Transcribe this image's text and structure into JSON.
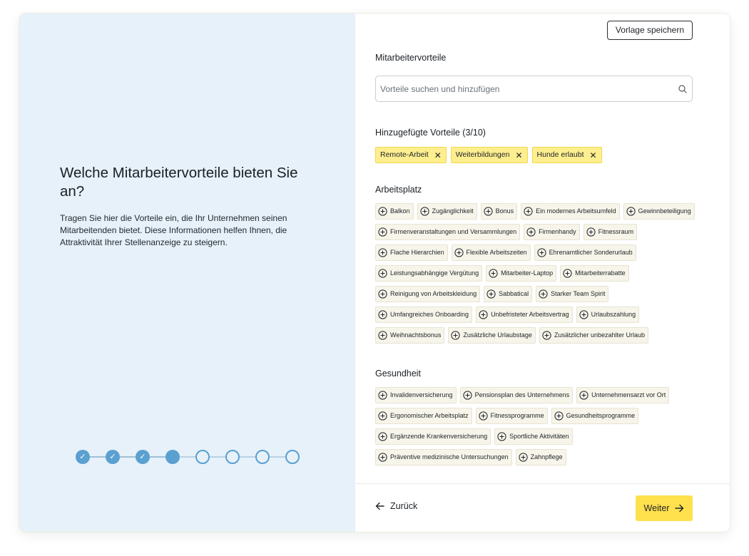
{
  "intro": {
    "heading": "Welche Mitarbeitervorteile bieten Sie an?",
    "description": "Tragen Sie hier die Vorteile ein, die Ihr Unternehmen seinen Mitarbeitenden bietet. Diese Informationen helfen Ihnen, die Attraktivität Ihrer Stellenanzeige zu steigern."
  },
  "stepper": {
    "total_steps": 8,
    "completed_steps": 3,
    "current_step": 4,
    "check_glyph": "✓"
  },
  "toolbar": {
    "save_template_label": "Vorlage speichern"
  },
  "benefits": {
    "title": "Mitarbeitervorteile",
    "search_placeholder": "Vorteile suchen und hinzufügen",
    "search_icon": "search-icon"
  },
  "added": {
    "title": "Hinzugefügte Vorteile (3/10)",
    "remove_glyph": "✕",
    "items": [
      "Remote-Arbeit",
      "Weiterbildungen",
      "Hunde erlaubt"
    ]
  },
  "categories": {
    "workplace": {
      "title": "Arbeitsplatz",
      "items": [
        "Balkon",
        "Zugänglichkeit",
        "Bonus",
        "Ein modernes Arbeitsumfeld",
        "Gewinnbeteiligung",
        "Firmenveranstaltungen und Versammlungen",
        "Firmenhandy",
        "Fitnessraum",
        "Flache Hierarchien",
        "Flexible Arbeitszeiten",
        "Ehrenamtlicher Sonderurlaub",
        "Leistungsabhängige Vergütung",
        "Mitarbeiter-Laptop",
        "Mitarbeiterrabatte",
        "Reinigung von Arbeitskleidung",
        "Sabbatical",
        "Starker Team Spirit",
        "Umfangreiches Onboarding",
        "Unbefristeter Arbeitsvertrag",
        "Urlaubszahlung",
        "Weihnachtsbonus",
        "Zusätzliche Urlaubstage",
        "Zusätzlicher unbezahlter Urlaub"
      ]
    },
    "health": {
      "title": "Gesundheit",
      "items": [
        "Invalidenversicherung",
        "Pensionsplan des Unternehmens",
        "Unternehmensarzt vor Ort",
        "Ergonomischer Arbeitsplatz",
        "Fitnessprogramme",
        "Gesundheitsprogramme",
        "Ergänzende Krankenversicherung",
        "Sportliche Aktivitäten",
        "Präventive medizinische Untersuchungen",
        "Zahnpflege"
      ]
    }
  },
  "footer": {
    "back_label": "Zurück",
    "next_label": "Weiter"
  },
  "colors": {
    "left_panel_bg": "#e6f1f9",
    "stepper_accent": "#5aa0d0",
    "added_chip_bg": "#fdee8f",
    "chip_bg": "#f7f5ea",
    "primary_button": "#ffe04d"
  }
}
